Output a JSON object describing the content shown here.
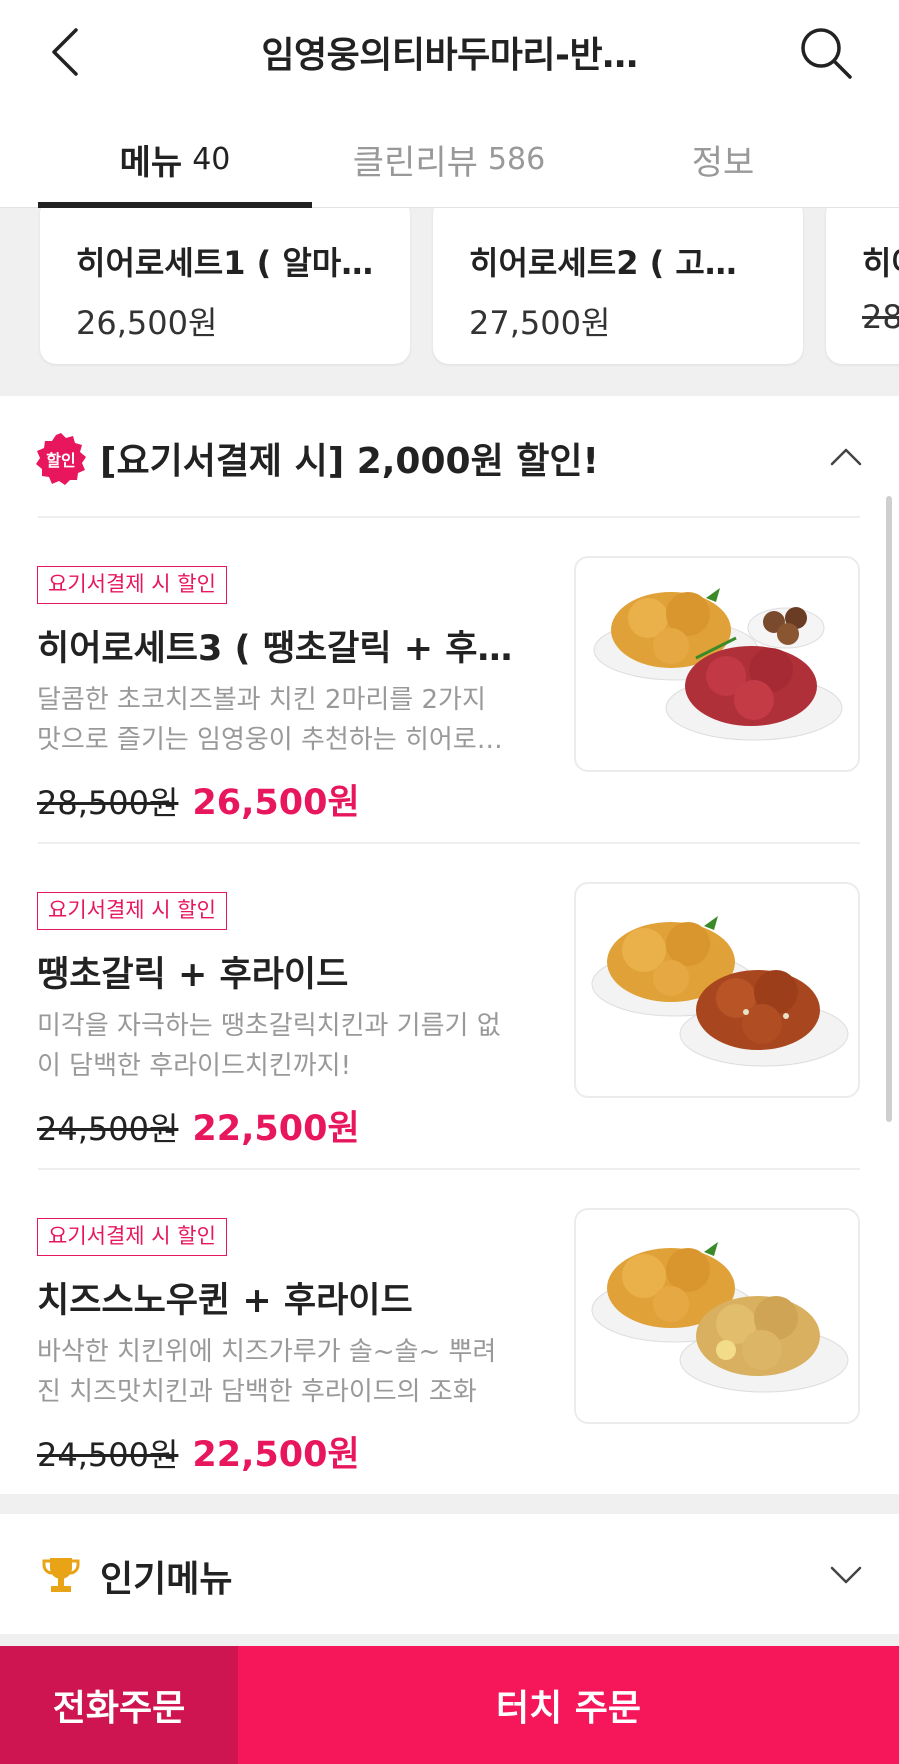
{
  "header": {
    "title": "임영웅의티바두마리-반…",
    "back_icon": "back-arrow-icon",
    "search_icon": "search-icon"
  },
  "tabs": [
    {
      "label": "메뉴",
      "count": "40",
      "active": true
    },
    {
      "label": "클린리뷰",
      "count": "586",
      "active": false
    },
    {
      "label": "정보",
      "count": "",
      "active": false
    }
  ],
  "set_cards": [
    {
      "name": "히어로세트1 ( 알마…",
      "price": "26,500원"
    },
    {
      "name": "히어로세트2 ( 고…",
      "price": "27,500원"
    },
    {
      "name": "히어",
      "price": "28,"
    }
  ],
  "discount_section": {
    "badge": "할인",
    "title": "[요기서결제 시] 2,000원 할인!",
    "items": [
      {
        "tag": "요기서결제 시 할인",
        "name": "히어로세트3 ( 땡초갈릭 + 후라…",
        "desc": "달콤한 초코치즈볼과 치킨 2마리를 2가지 맛으로 즐기는 임영웅이 추천하는 히어로…",
        "orig_price": "28,500원",
        "sale_price": "26,500원",
        "image_extra": "choco-balls"
      },
      {
        "tag": "요기서결제 시 할인",
        "name": "땡초갈릭 + 후라이드",
        "desc": "미각을 자극하는 땡초갈릭치킨과 기름기 없이 담백한 후라이드치킨까지!",
        "orig_price": "24,500원",
        "sale_price": "22,500원",
        "image_extra": "none"
      },
      {
        "tag": "요기서결제 시 할인",
        "name": "치즈스노우퀸 + 후라이드",
        "desc": "바삭한 치킨위에 치즈가루가 솔~솔~ 뿌려진 치즈맛치킨과 담백한 후라이드의 조화",
        "orig_price": "24,500원",
        "sale_price": "22,500원",
        "image_extra": "none"
      }
    ]
  },
  "popular": {
    "title": "인기메뉴",
    "icon": "trophy-icon"
  },
  "bottom": {
    "phone_order": "전화주문",
    "touch_order": "터치 주문"
  },
  "colors": {
    "accent": "#e8175d",
    "phone_order_bg": "#cf1452",
    "touch_order_bg": "#f5175a"
  }
}
